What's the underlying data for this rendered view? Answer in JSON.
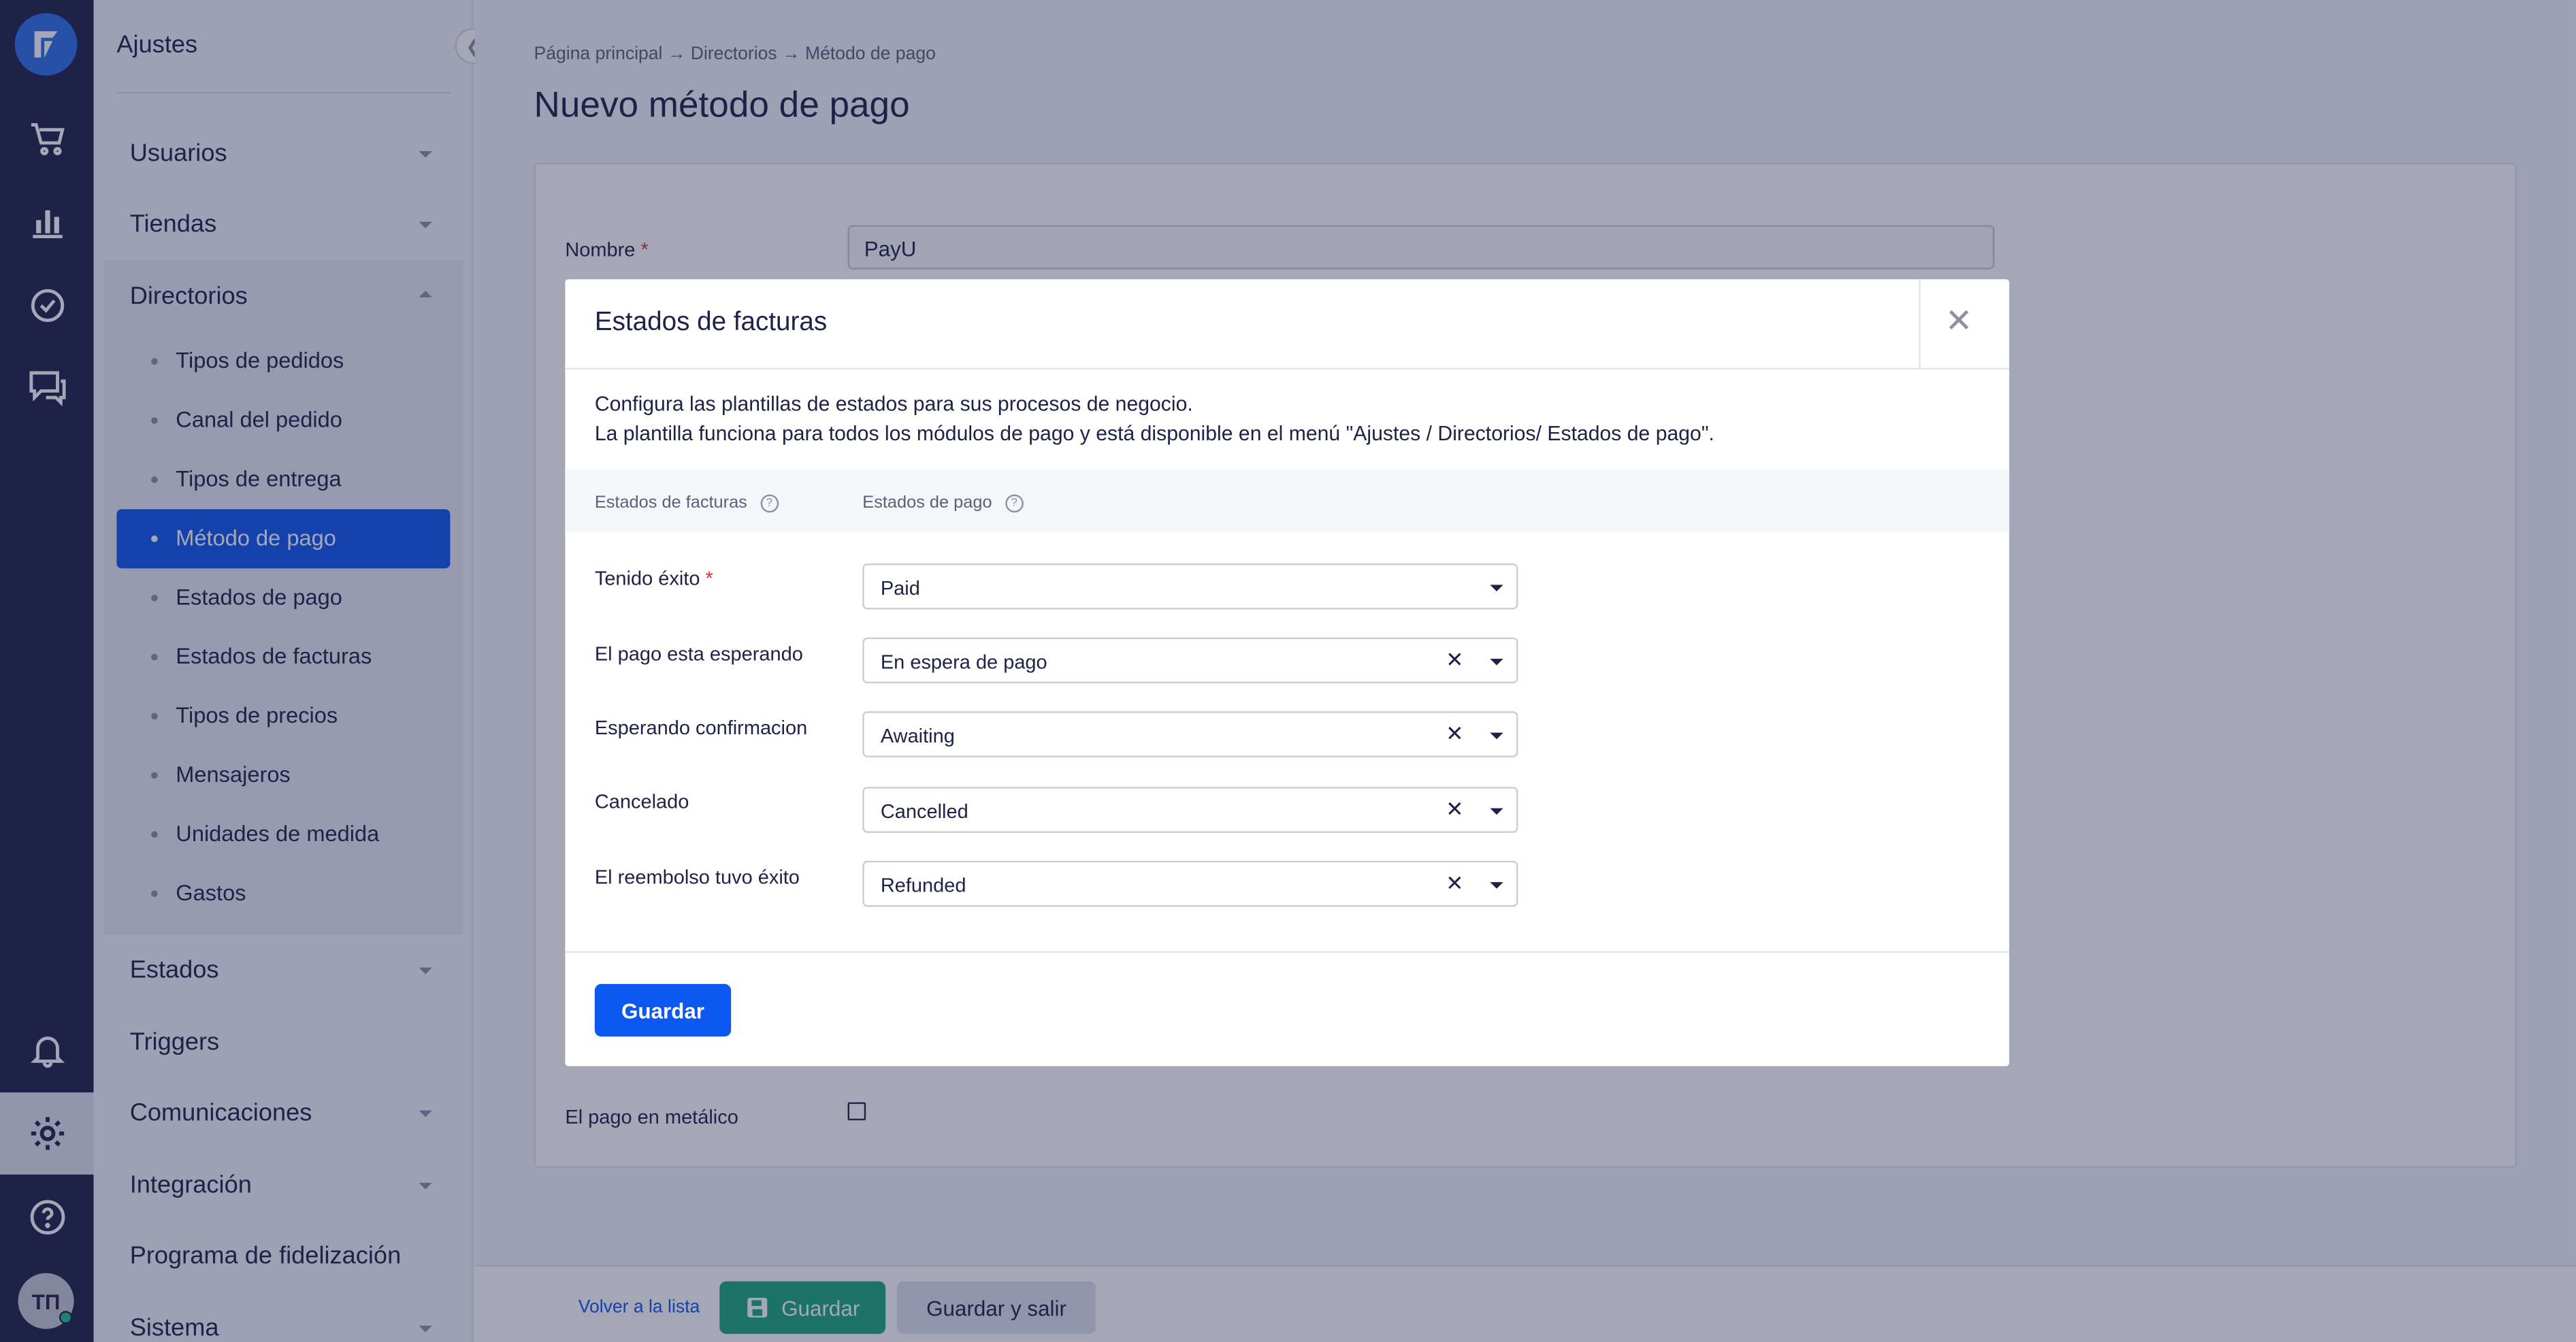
{
  "sidebar": {
    "title": "Ajustes",
    "sections": [
      {
        "label": "Usuarios"
      },
      {
        "label": "Tiendas"
      },
      {
        "label": "Directorios"
      },
      {
        "label": "Estados"
      },
      {
        "label": "Triggers"
      },
      {
        "label": "Comunicaciones"
      },
      {
        "label": "Integración"
      },
      {
        "label": "Programa de fidelización"
      },
      {
        "label": "Sistema"
      }
    ],
    "directorios_items": [
      {
        "label": "Tipos de pedidos"
      },
      {
        "label": "Canal del pedido"
      },
      {
        "label": "Tipos de entrega"
      },
      {
        "label": "Método de pago",
        "active": true
      },
      {
        "label": "Estados de pago"
      },
      {
        "label": "Estados de facturas"
      },
      {
        "label": "Tipos de precios"
      },
      {
        "label": "Mensajeros"
      },
      {
        "label": "Unidades de medida"
      },
      {
        "label": "Gastos"
      }
    ]
  },
  "rail": {
    "icons": [
      "logo-icon",
      "cart-icon",
      "analytics-icon",
      "tasks-icon",
      "chat-icon",
      "bell-icon",
      "gear-icon",
      "help-icon"
    ],
    "avatar_initials": "ТП"
  },
  "page": {
    "breadcrumb": "Página principal → Directorios → Método de pago",
    "title": "Nuevo método de pago",
    "name_label": "Nombre",
    "name_value": "PayU",
    "cash_label": "El pago en metálico"
  },
  "footer": {
    "back": "Volver a la lista",
    "save": "Guardar",
    "save_exit": "Guardar y salir"
  },
  "modal": {
    "title": "Estados de facturas",
    "desc_line1": "Configura las plantillas de estados para sus procesos de negocio.",
    "desc_line2": "La plantilla funciona para todos los módulos de pago y está disponible en el menú \"Ajustes / Directorios/ Estados de pago\".",
    "col1": "Estados de facturas",
    "col2": "Estados de pago",
    "rows": [
      {
        "label": "Tenido éxito",
        "value": "Paid"
      },
      {
        "label": "El pago esta esperando",
        "value": "En espera de pago"
      },
      {
        "label": "Esperando confirmacion",
        "value": "Awaiting"
      },
      {
        "label": "Cancelado",
        "value": "Cancelled"
      },
      {
        "label": "El reembolso tuvo éxito",
        "value": "Refunded"
      }
    ],
    "save": "Guardar"
  },
  "colors": {
    "rail": "#1e2248",
    "primary": "#0d58f0",
    "success": "#1ca97a",
    "required": "#e5322d"
  }
}
